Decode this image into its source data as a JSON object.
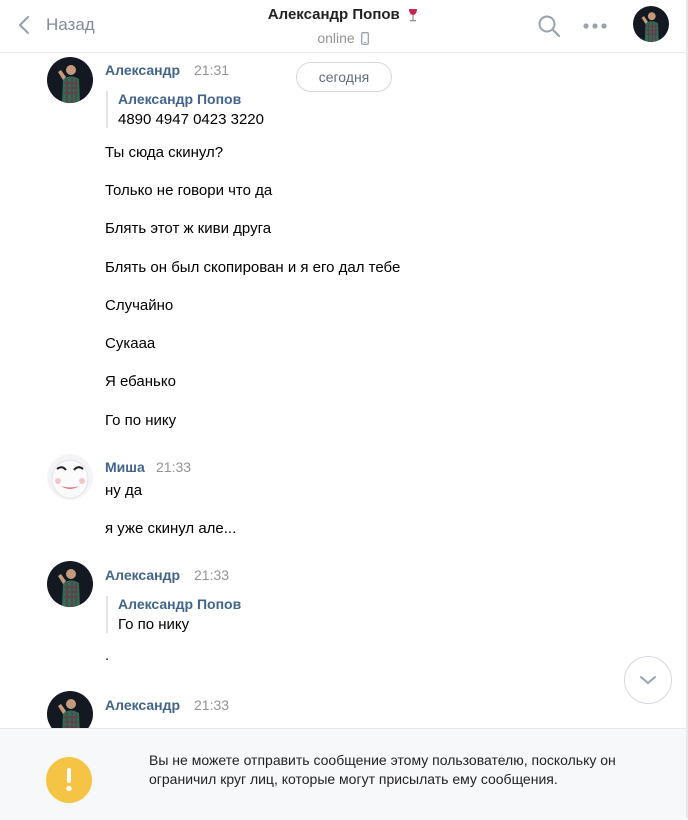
{
  "header": {
    "back_label": "Назад",
    "title": "Александр Попов",
    "status": "online"
  },
  "chat": {
    "day_label": "сегодня",
    "messages": [
      {
        "author": "Александр",
        "time": "21:31",
        "quote": {
          "author": "Александр Попов",
          "text": "4890 4947 0423 3220"
        },
        "lines": [
          "Ты сюда скинул?",
          "Только не говори что да",
          "Блять этот ж киви друга",
          "Блять он был скопирован и я его дал тебе",
          "Случайно",
          "Сукааа",
          "Я ебанько",
          "Го по нику"
        ]
      },
      {
        "author": "Миша",
        "time": "21:33",
        "lines": [
          "ну да",
          "я уже скинул але..."
        ]
      },
      {
        "author": "Александр",
        "time": "21:33",
        "quote": {
          "author": "Александр Попов",
          "text": "Го по нику"
        },
        "lines": [
          "."
        ]
      },
      {
        "author": "Александр",
        "time": "21:33",
        "lines": []
      }
    ]
  },
  "footer": {
    "notice": "Вы не можете отправить сообщение этому пользователю, поскольку он ограничил круг лиц, которые могут присылать ему сообщения."
  },
  "icons": {
    "back": "chevron-left-icon",
    "search": "search-icon",
    "more": "more-dots-icon",
    "status": "mobile-phone-icon",
    "title_emoji": "wine-glass-icon",
    "scroll": "chevron-down-icon",
    "warning": "exclamation-icon"
  },
  "colors": {
    "link": "#42648b",
    "muted": "#939393",
    "warning": "#f6c445",
    "border": "#e7e8ec"
  }
}
